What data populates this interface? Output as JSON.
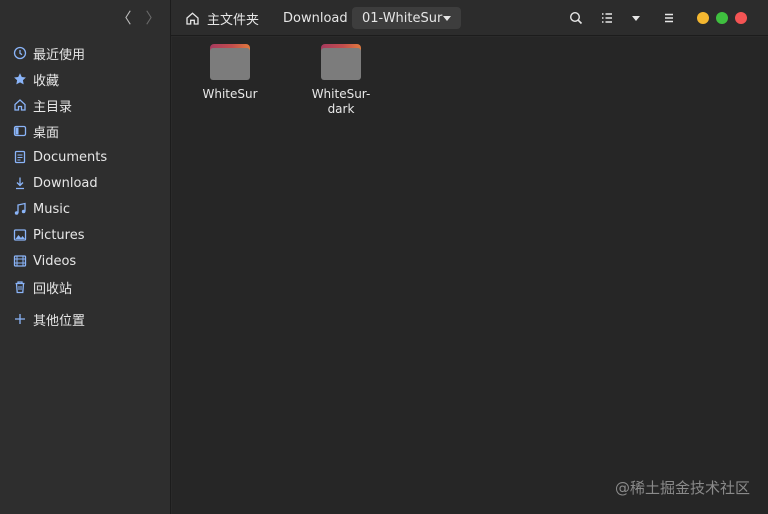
{
  "sidebar": {
    "items": [
      {
        "label": "最近使用",
        "icon": "clock-icon"
      },
      {
        "label": "收藏",
        "icon": "star-icon"
      },
      {
        "label": "主目录",
        "icon": "home-icon"
      },
      {
        "label": "桌面",
        "icon": "desktop-icon"
      },
      {
        "label": "Documents",
        "icon": "document-icon"
      },
      {
        "label": "Download",
        "icon": "download-icon"
      },
      {
        "label": "Music",
        "icon": "music-icon"
      },
      {
        "label": "Pictures",
        "icon": "picture-icon"
      },
      {
        "label": "Videos",
        "icon": "video-icon"
      },
      {
        "label": "回收站",
        "icon": "trash-icon"
      }
    ],
    "other_locations": {
      "label": "其他位置",
      "icon": "plus-icon"
    }
  },
  "breadcrumb": {
    "home": "主文件夹",
    "parent": "Download",
    "current": "01-WhiteSur"
  },
  "files": [
    {
      "name": "WhiteSur",
      "type": "folder"
    },
    {
      "name": "WhiteSur-dark",
      "type": "folder"
    }
  ],
  "watermark": "@稀土掘金技术社区",
  "colors": {
    "accent": "#8ab4f8",
    "folder_top_from": "#a63a5e",
    "folder_top_to": "#e07a3e",
    "folder_body": "#7c7c7c"
  }
}
